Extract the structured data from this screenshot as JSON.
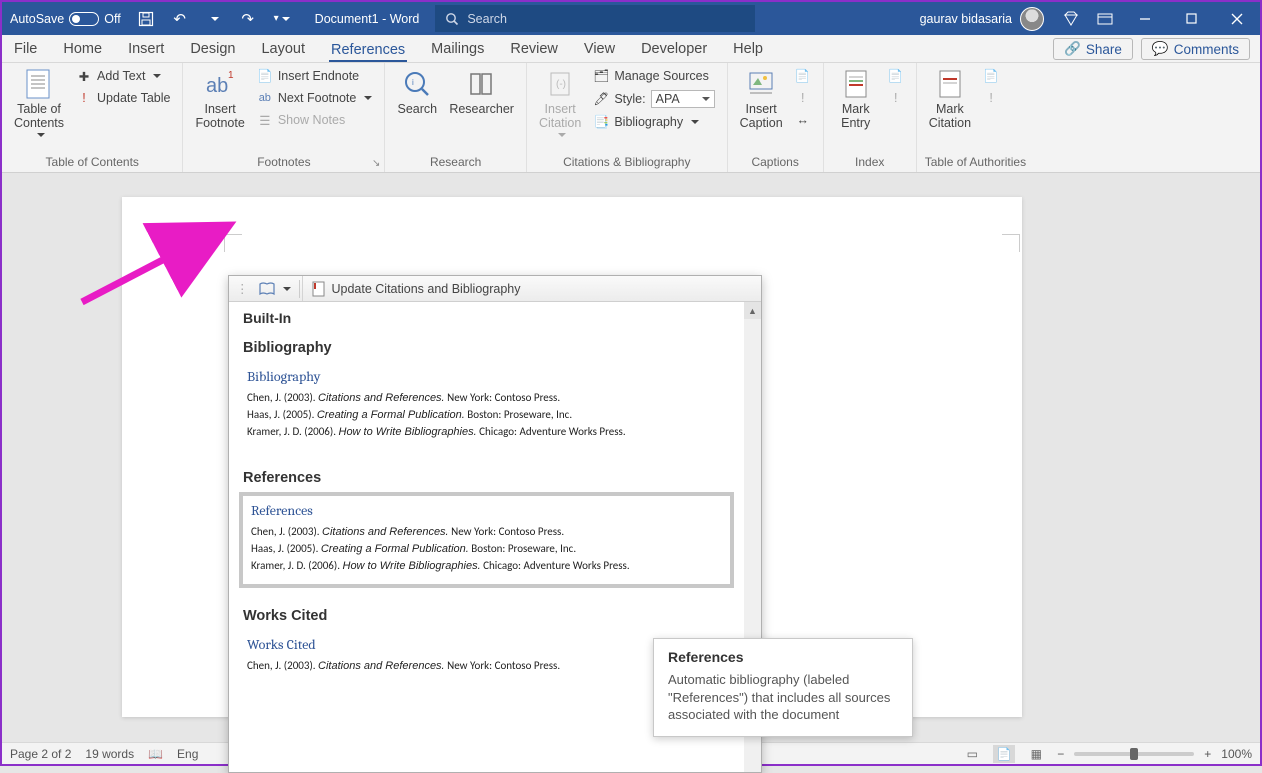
{
  "titlebar": {
    "autosave_label": "AutoSave",
    "autosave_state": "Off",
    "doc_title": "Document1 - Word",
    "search_placeholder": "Search",
    "user_name": "gaurav bidasaria"
  },
  "tabs": {
    "items": [
      "File",
      "Home",
      "Insert",
      "Design",
      "Layout",
      "References",
      "Mailings",
      "Review",
      "View",
      "Developer",
      "Help"
    ],
    "active_index": 5,
    "share": "Share",
    "comments": "Comments"
  },
  "ribbon": {
    "toc": {
      "big": "Table of\nContents",
      "add_text": "Add Text",
      "update_table": "Update Table",
      "group_label": "Table of Contents"
    },
    "footnotes": {
      "big": "Insert\nFootnote",
      "insert_endnote": "Insert Endnote",
      "next_footnote": "Next Footnote",
      "show_notes": "Show Notes",
      "group_label": "Footnotes"
    },
    "research": {
      "search": "Search",
      "researcher": "Researcher",
      "group_label": "Research"
    },
    "citations": {
      "insert_citation": "Insert\nCitation",
      "manage_sources": "Manage Sources",
      "style_label": "Style:",
      "style_value": "APA",
      "bibliography": "Bibliography",
      "group_label": "Citations & Bibliography"
    },
    "captions": {
      "insert_caption": "Insert\nCaption",
      "group_label": "Captions"
    },
    "index": {
      "mark_entry": "Mark\nEntry",
      "group_label": "Index"
    },
    "authorities": {
      "mark_citation": "Mark\nCitation",
      "group_label": "Table of Authorities"
    }
  },
  "gallery": {
    "update_btn": "Update Citations and Bibliography",
    "builtin_label": "Built-In",
    "items": [
      {
        "header": "Bibliography",
        "title": "Bibliography",
        "entries": [
          {
            "author": "Chen, J. (2003).",
            "title": "Citations and References.",
            "pub": "New York: Contoso Press."
          },
          {
            "author": "Haas, J. (2005).",
            "title": "Creating a Formal Publication.",
            "pub": "Boston: Proseware, Inc."
          },
          {
            "author": "Kramer, J. D. (2006).",
            "title": "How to Write Bibliographies.",
            "pub": "Chicago: Adventure Works Press."
          }
        ]
      },
      {
        "header": "References",
        "title": "References",
        "entries": [
          {
            "author": "Chen, J. (2003).",
            "title": "Citations and References.",
            "pub": "New York: Contoso Press."
          },
          {
            "author": "Haas, J. (2005).",
            "title": "Creating a Formal Publication.",
            "pub": "Boston: Proseware, Inc."
          },
          {
            "author": "Kramer, J. D. (2006).",
            "title": "How to Write Bibliographies.",
            "pub": "Chicago: Adventure Works Press."
          }
        ]
      },
      {
        "header": "Works Cited",
        "title": "Works Cited",
        "entries": [
          {
            "author": "Chen, J. (2003).",
            "title": "Citations and References.",
            "pub": "New York: Contoso Press."
          }
        ]
      }
    ],
    "selected_index": 1
  },
  "tooltip": {
    "title": "References",
    "body": "Automatic bibliography (labeled \"References\") that includes all sources associated with the document"
  },
  "statusbar": {
    "page": "Page 2 of 2",
    "words": "19 words",
    "lang": "Eng",
    "zoom": "100%"
  }
}
